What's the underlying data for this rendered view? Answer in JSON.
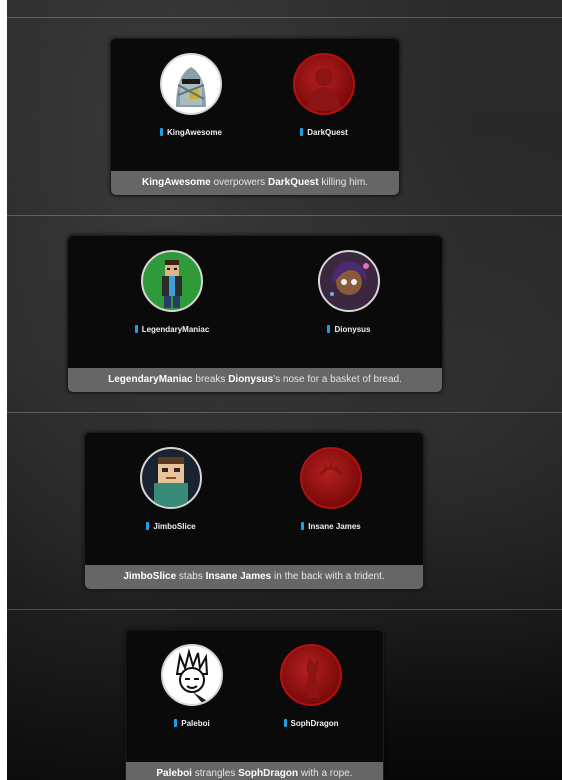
{
  "events": [
    {
      "tribute_1": {
        "name": "KingAwesome",
        "status": "alive"
      },
      "tribute_2": {
        "name": "DarkQuest",
        "status": "dead"
      },
      "text": {
        "actor": "KingAwesome",
        "action_1": " overpowers ",
        "target": "DarkQuest",
        "action_2": " killing him."
      }
    },
    {
      "tribute_1": {
        "name": "LegendaryManiac",
        "status": "alive"
      },
      "tribute_2": {
        "name": "Dionysus",
        "status": "alive"
      },
      "text": {
        "actor": "LegendaryManiac",
        "action_1": " breaks ",
        "target": "Dionysus",
        "action_2": "'s nose for a basket of bread."
      }
    },
    {
      "tribute_1": {
        "name": "JimboSlice",
        "status": "alive"
      },
      "tribute_2": {
        "name": "Insane James",
        "status": "dead"
      },
      "text": {
        "actor": "JimboSlice",
        "action_1": " stabs ",
        "target": "Insane James",
        "action_2": " in the back with a trident."
      }
    },
    {
      "tribute_1": {
        "name": "Paleboi",
        "status": "alive"
      },
      "tribute_2": {
        "name": "SophDragon",
        "status": "dead"
      },
      "text": {
        "actor": "Paleboi",
        "action_1": " strangles ",
        "target": "SophDragon",
        "action_2": " with a rope."
      }
    }
  ],
  "colors": {
    "district_marker": "#1ea0e8",
    "dead_avatar": "#b21111",
    "caption_bar": "#666666"
  }
}
